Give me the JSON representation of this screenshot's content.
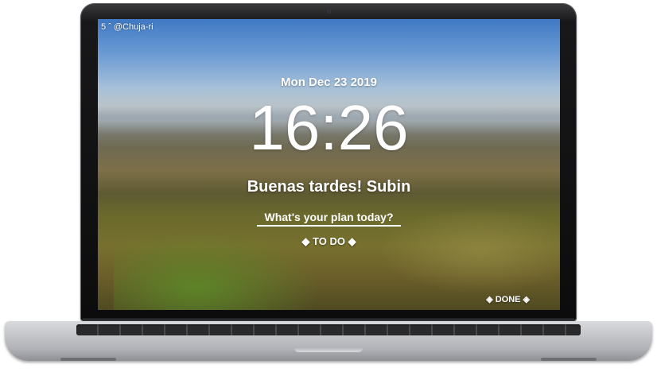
{
  "screen": {
    "credit": "5 ˆ @Chuja-ri",
    "date": "Mon Dec 23 2019",
    "clock": "16:26",
    "greeting": "Buenas tardes! Subin",
    "plan_input": {
      "placeholder": "What's your plan today?",
      "value": ""
    },
    "todo_label": "◆ TO DO ◆",
    "done_label": "◈ DONE ◈"
  },
  "colors": {
    "sky_top": "#3f79c4",
    "text": "#ffffff",
    "laptop_bezel": "#0c0c0d",
    "laptop_body": "#c4c6ca"
  },
  "icons": {
    "camera": "camera-icon"
  }
}
